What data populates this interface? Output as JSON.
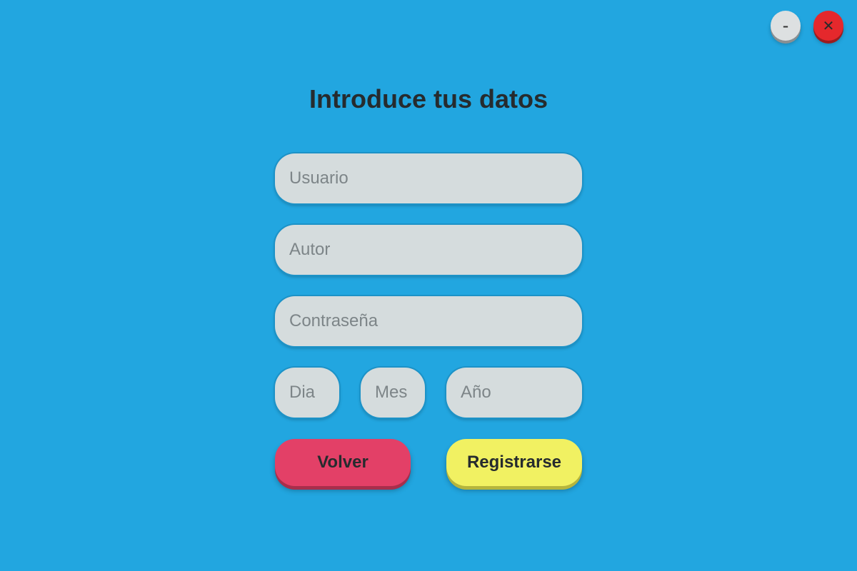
{
  "window_controls": {
    "minimize_label": "–",
    "minimize_icon": "minimize-icon",
    "close_label": "✕",
    "close_icon": "close-icon"
  },
  "form": {
    "title": "Introduce tus datos",
    "fields": {
      "usuario": {
        "placeholder": "Usuario",
        "value": ""
      },
      "autor": {
        "placeholder": "Autor",
        "value": ""
      },
      "contrasena": {
        "placeholder": "Contraseña",
        "value": ""
      },
      "dia": {
        "placeholder": "Dia",
        "value": ""
      },
      "mes": {
        "placeholder": "Mes",
        "value": ""
      },
      "ano": {
        "placeholder": "Año",
        "value": ""
      }
    },
    "buttons": {
      "back_label": "Volver",
      "register_label": "Registrarse"
    }
  },
  "colors": {
    "background": "#22a6e0",
    "field_background": "#d5dcdd",
    "back_button": "#e34067",
    "register_button": "#f1f162",
    "close_button": "#e5282c",
    "minimize_button": "#dde0e1",
    "title_text": "#262b2e"
  }
}
